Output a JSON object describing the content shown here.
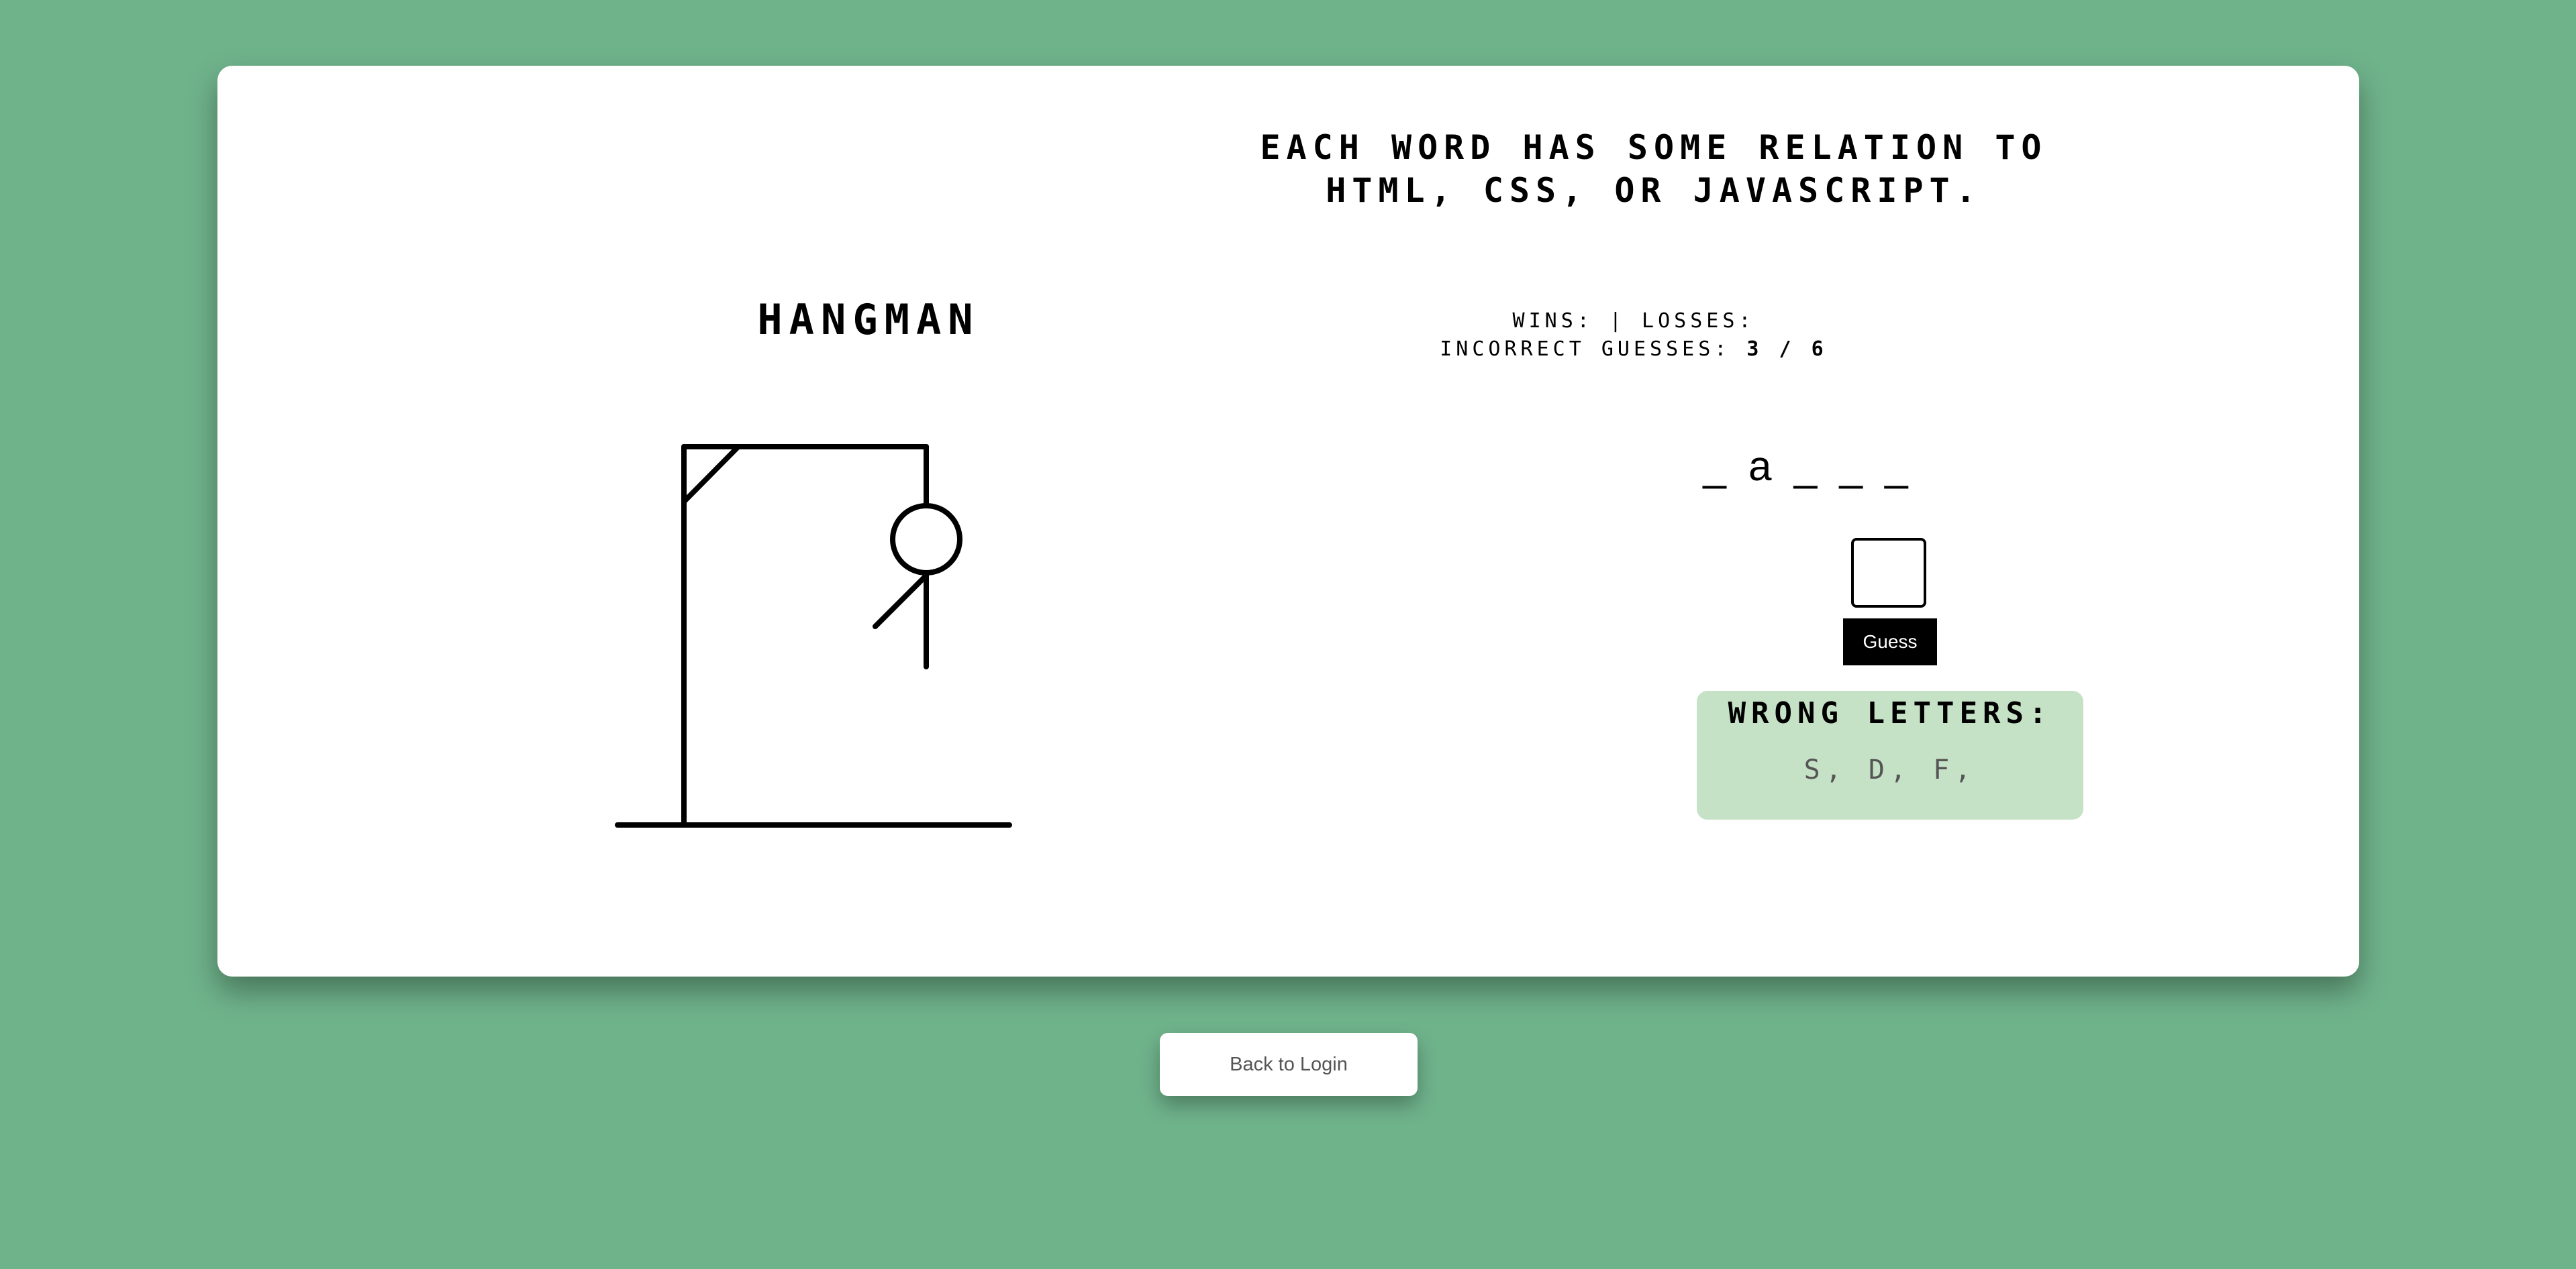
{
  "hint_text": "Each word has some relation to HTML, CSS, or JavaScript.",
  "title": "HANGMAN",
  "stats": {
    "wins_label": "Wins:",
    "separator": "|",
    "losses_label": "Losses:",
    "incorrect_label": "Incorrect Guesses:",
    "incorrect_value": "3 / 6"
  },
  "word_display": "_ a _ _ _",
  "guess": {
    "input_value": "",
    "button_label": "Guess"
  },
  "wrong_letters": {
    "title": "Wrong Letters:",
    "list": "S, D, F,"
  },
  "back_button_label": "Back to Login",
  "hangman": {
    "incorrect_guesses": 3,
    "max_guesses": 6,
    "visible_parts": [
      "head",
      "body",
      "left-arm"
    ]
  },
  "colors": {
    "background": "#6fb38b",
    "card": "#ffffff",
    "wrong_box": "#c5e2c6",
    "button": "#000000"
  }
}
